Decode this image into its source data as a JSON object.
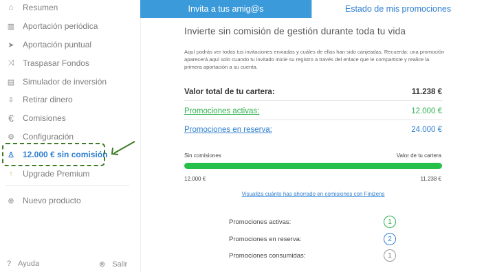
{
  "sidebar": {
    "items": [
      {
        "label": "Resumen",
        "icon": "home-icon",
        "glyph": "⌂"
      },
      {
        "label": "Aportación periódica",
        "icon": "bar-chart-icon",
        "glyph": "▥"
      },
      {
        "label": "Aportación puntual",
        "icon": "paper-plane-icon",
        "glyph": "➤"
      },
      {
        "label": "Traspasar Fondos",
        "icon": "shuffle-icon",
        "glyph": "⤨"
      },
      {
        "label": "Simulador de inversión",
        "icon": "calculator-icon",
        "glyph": "▤"
      },
      {
        "label": "Retirar dinero",
        "icon": "withdraw-icon",
        "glyph": "⇩"
      },
      {
        "label": "Comisiones",
        "icon": "euro-icon",
        "glyph": "€"
      },
      {
        "label": "Configuración",
        "icon": "gear-icon",
        "glyph": "⚙"
      },
      {
        "label": "12.000 € sin comisión",
        "icon": "user-icon",
        "glyph": "♙"
      },
      {
        "label": "Upgrade Premium",
        "icon": "arrow-up-icon",
        "glyph": "↑"
      },
      {
        "label": "Nuevo producto",
        "icon": "plus-circle-icon",
        "glyph": "⊕"
      }
    ],
    "help_label": "Ayuda",
    "logout_label": "Salir"
  },
  "tabs": {
    "invite": "Invita a tus amig@s",
    "status": "Estado de mis promociones"
  },
  "main": {
    "title": "Invierte sin comisión de gestión durante toda tu vida",
    "description": "Aquí podrás ver todas tus invitaciones enviadas y cuáles de ellas han sido canjeadas. Recuerda: una promoción aparecerá aquí solo cuando tu invitado inicie su registro a través del enlace que le compartiste y realice la primera aportación a su cuenta.",
    "portfolio_label": "Valor total de tu cartera:",
    "portfolio_value": "11.238 €",
    "active_label": "Promociones activas:",
    "active_value": "12.000 €",
    "reserve_label": "Promociones en reserva:",
    "reserve_value": "24.000 €",
    "bar_left_label": "Sin comisiones",
    "bar_right_label": "Valor de tu cartera",
    "bar_left_value": "12.000 €",
    "bar_right_value": "11.238 €",
    "bar_fill_fraction": 1.0,
    "savings_link": "Visualiza cuánto has ahorrado en comisiones con Finizens",
    "promo_active_label": "Promociones activas:",
    "promo_active_count": "1",
    "promo_reserve_label": "Promociones en reserva:",
    "promo_reserve_count": "2",
    "promo_used_label": "Promociones consumidas:",
    "promo_used_count": "1"
  },
  "colors": {
    "accent_blue": "#2f7fd0",
    "tab_blue": "#3b9ad9",
    "green": "#2fb04d",
    "highlight_dash": "#3d7b27"
  }
}
